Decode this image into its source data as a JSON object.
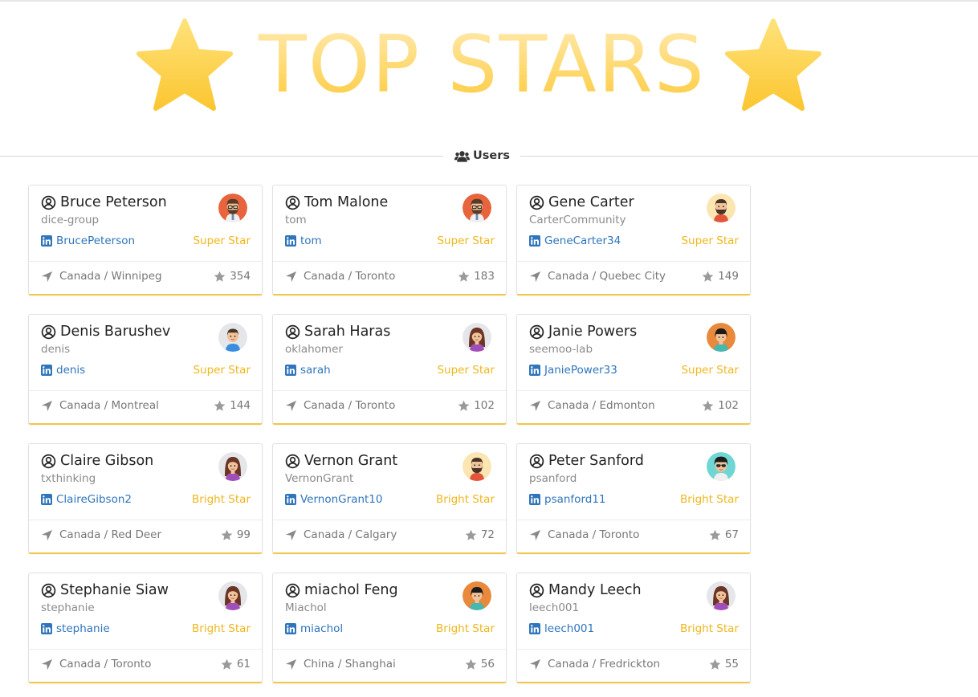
{
  "page": {
    "title": "TOP STARS",
    "section_label": "Users",
    "title_colors": [
      "#ffeab2",
      "#fcca3c"
    ],
    "star_color": "#fcce3f"
  },
  "users": [
    {
      "name": "Bruce Peterson",
      "login": "dice-group",
      "linkedin": "BrucePeterson",
      "rank": "Super Star",
      "country": "Canada",
      "city": "Winnipeg",
      "stars": "354",
      "avatar": "man-glasses-orange-icon"
    },
    {
      "name": "Tom Malone",
      "login": "tom",
      "linkedin": "tom",
      "rank": "Super Star",
      "country": "Canada",
      "city": "Toronto",
      "stars": "183",
      "avatar": "man-glasses-orange-icon"
    },
    {
      "name": "Gene Carter",
      "login": "CarterCommunity",
      "linkedin": "GeneCarter34",
      "rank": "Super Star",
      "country": "Canada",
      "city": "Quebec City",
      "stars": "149",
      "avatar": "man-beard-yellow-icon"
    },
    {
      "name": "Denis Barushev",
      "login": "denis",
      "linkedin": "denis",
      "rank": "Super Star",
      "country": "Canada",
      "city": "Montreal",
      "stars": "144",
      "avatar": "man-blue-shirt-icon"
    },
    {
      "name": "Sarah Haras",
      "login": "oklahomer",
      "linkedin": "sarah",
      "rank": "Super Star",
      "country": "Canada",
      "city": "Toronto",
      "stars": "102",
      "avatar": "woman-brown-hair-icon"
    },
    {
      "name": "Janie Powers",
      "login": "seemoo-lab",
      "linkedin": "JaniePower33",
      "rank": "Super Star",
      "country": "Canada",
      "city": "Edmonton",
      "stars": "102",
      "avatar": "person-black-hair-orange-icon"
    },
    {
      "name": "Claire Gibson",
      "login": "txthinking",
      "linkedin": "ClaireGibson2",
      "rank": "Bright Star",
      "country": "Canada",
      "city": "Red Deer",
      "stars": "99",
      "avatar": "woman-brown-hair-icon"
    },
    {
      "name": "Vernon Grant",
      "login": "VernonGrant",
      "linkedin": "VernonGrant10",
      "rank": "Bright Star",
      "country": "Canada",
      "city": "Calgary",
      "stars": "72",
      "avatar": "man-beard-yellow-icon"
    },
    {
      "name": "Peter Sanford",
      "login": "psanford",
      "linkedin": "psanford11",
      "rank": "Bright Star",
      "country": "Canada",
      "city": "Toronto",
      "stars": "67",
      "avatar": "man-sunglasses-teal-icon"
    },
    {
      "name": "Stephanie Siaw",
      "login": "stephanie",
      "linkedin": "stephanie",
      "rank": "Bright Star",
      "country": "Canada",
      "city": "Toronto",
      "stars": "61",
      "avatar": "woman-brown-hair-icon"
    },
    {
      "name": "miachol Feng",
      "login": "Miachol",
      "linkedin": "miachol",
      "rank": "Bright Star",
      "country": "China",
      "city": "Shanghai",
      "stars": "56",
      "avatar": "person-black-hair-orange-icon"
    },
    {
      "name": "Mandy Leech",
      "login": "leech001",
      "linkedin": "leech001",
      "rank": "Bright Star",
      "country": "Canada",
      "city": "Fredrickton",
      "stars": "55",
      "avatar": "woman-brown-hair-icon"
    }
  ]
}
